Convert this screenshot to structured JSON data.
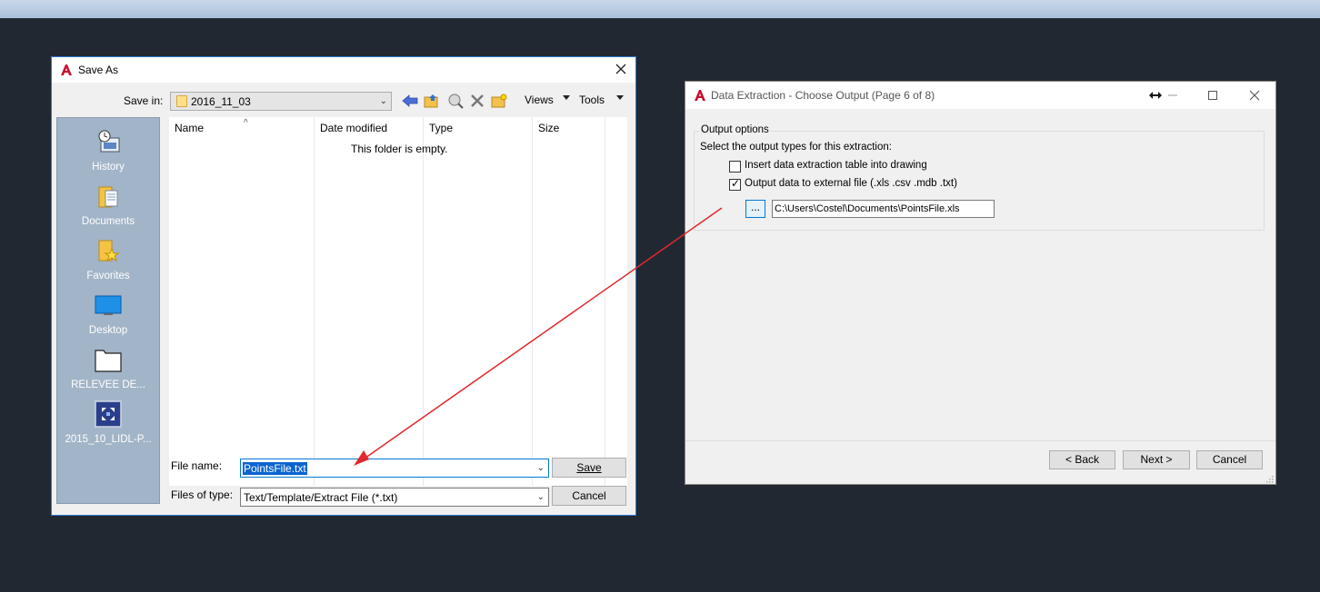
{
  "save_as": {
    "title": "Save As",
    "save_in_label": "Save in:",
    "save_in_value": "2016_11_03",
    "toolbar": {
      "back_icon": "back-arrow-icon",
      "up_icon": "up-folder-icon",
      "search_icon": "search-web-icon",
      "delete_icon": "delete-icon",
      "new_folder_icon": "new-folder-icon",
      "views_label": "Views",
      "tools_label": "Tools"
    },
    "places": [
      {
        "label": "History",
        "icon": "history-icon"
      },
      {
        "label": "Documents",
        "icon": "documents-icon"
      },
      {
        "label": "Favorites",
        "icon": "favorites-icon"
      },
      {
        "label": "Desktop",
        "icon": "desktop-icon"
      },
      {
        "label": "RELEVEE DE...",
        "icon": "folder-icon"
      },
      {
        "label": "2015_10_LIDL-P...",
        "icon": "shortcut-icon"
      }
    ],
    "columns": [
      "Name",
      "Date modified",
      "Type",
      "Size"
    ],
    "empty_message": "This folder is empty.",
    "file_name_label": "File name:",
    "file_name_value": "PointsFile.txt",
    "files_of_type_label": "Files of type:",
    "files_of_type_value": "Text/Template/Extract File (*.txt)",
    "save_button": "Save",
    "cancel_button": "Cancel"
  },
  "data_extraction": {
    "title": "Data Extraction - Choose Output (Page 6 of 8)",
    "group_title": "Output options",
    "instruction": "Select the output types for this extraction:",
    "option_insert_table": {
      "label": "Insert data extraction table into drawing",
      "checked": false
    },
    "option_external_file": {
      "label": "Output data to external file (.xls .csv .mdb .txt)",
      "checked": true
    },
    "browse_button": "...",
    "file_path": "C:\\Users\\Costel\\Documents\\PointsFile.xls",
    "back_button": "< Back",
    "next_button": "Next >",
    "cancel_button": "Cancel"
  },
  "colors": {
    "desktop_bg": "#222831",
    "dialog_bg": "#f0f0f0",
    "accent": "#0078d7",
    "annotation_arrow": "#e0282e",
    "autocad_red": "#c8102e"
  }
}
